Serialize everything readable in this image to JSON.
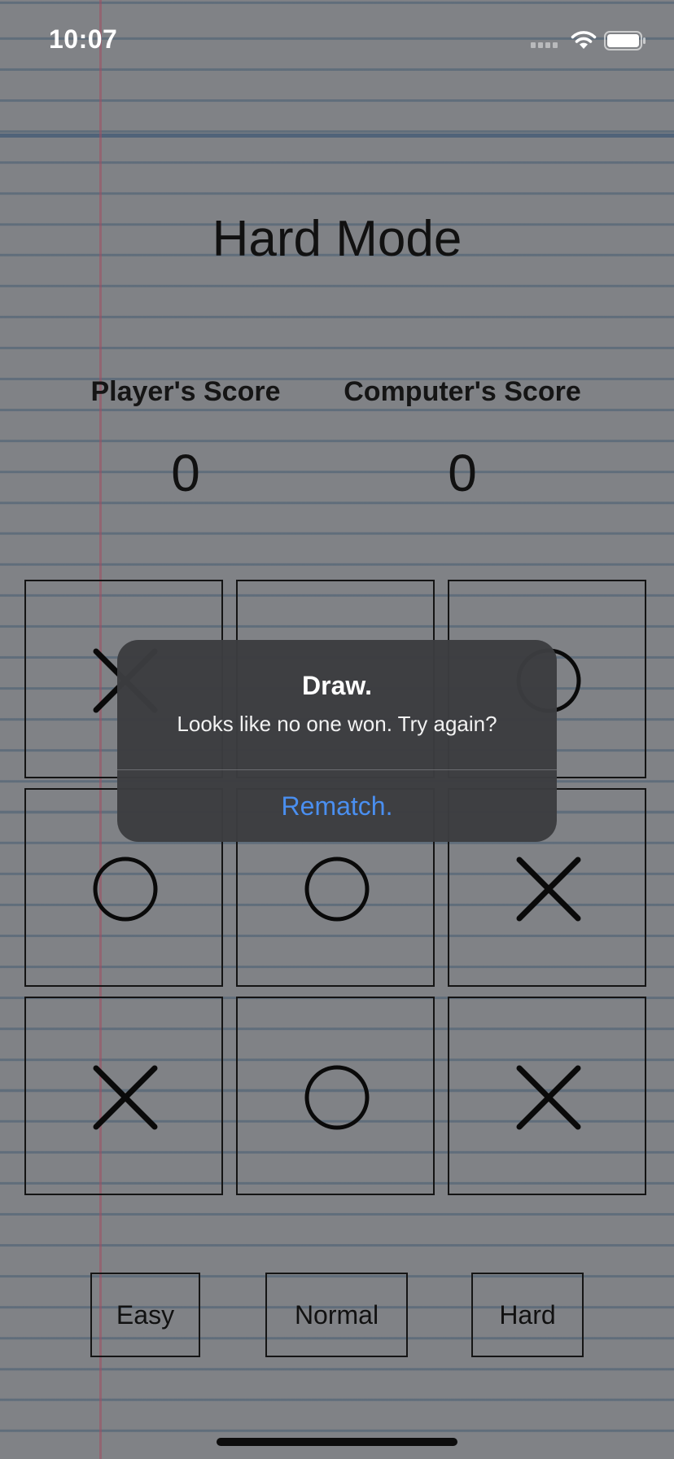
{
  "status_bar": {
    "time": "10:07"
  },
  "title": "Hard Mode",
  "scores": {
    "player_label": "Player's Score",
    "player_value": "0",
    "computer_label": "Computer's Score",
    "computer_value": "0"
  },
  "board": {
    "cells": [
      "X",
      "",
      "O",
      "O",
      "O",
      "X",
      "X",
      "O",
      "X"
    ]
  },
  "difficulty": {
    "easy": "Easy",
    "normal": "Normal",
    "hard": "Hard"
  },
  "alert": {
    "title": "Draw.",
    "message": "Looks like no one won. Try again?",
    "action": "Rematch."
  },
  "colors": {
    "alert_action": "#4a8ff0",
    "alert_background": "#3c3d40"
  }
}
